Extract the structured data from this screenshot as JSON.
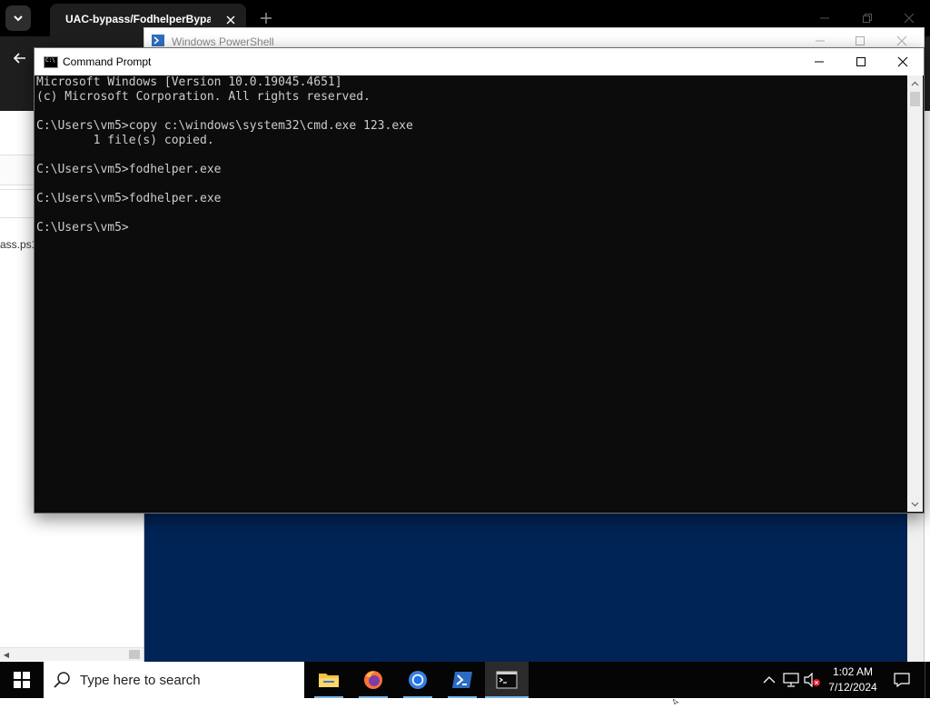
{
  "browser": {
    "tab_title": "UAC-bypass/FodhelperBypass.",
    "file_label": "ass.ps1"
  },
  "powershell": {
    "title": "Windows PowerShell"
  },
  "cmd": {
    "title": "Command Prompt",
    "console_lines": [
      "Microsoft Windows [Version 10.0.19045.4651]",
      "(c) Microsoft Corporation. All rights reserved.",
      "",
      "C:\\Users\\vm5>copy c:\\windows\\system32\\cmd.exe 123.exe",
      "        1 file(s) copied.",
      "",
      "C:\\Users\\vm5>fodhelper.exe",
      "",
      "C:\\Users\\vm5>fodhelper.exe",
      "",
      "C:\\Users\\vm5>"
    ]
  },
  "taskbar": {
    "search_placeholder": "Type here to search",
    "apps": [
      "file-explorer",
      "firefox",
      "chrome",
      "powershell",
      "command-prompt"
    ],
    "active_app": "command-prompt",
    "time": "1:02 AM",
    "date": "7/12/2024"
  },
  "colors": {
    "console_bg": "#0c0c0c",
    "console_text": "#cccccc",
    "powershell_bg": "#012456",
    "taskbar_bg": "#050505",
    "accent": "#76b9ed"
  }
}
